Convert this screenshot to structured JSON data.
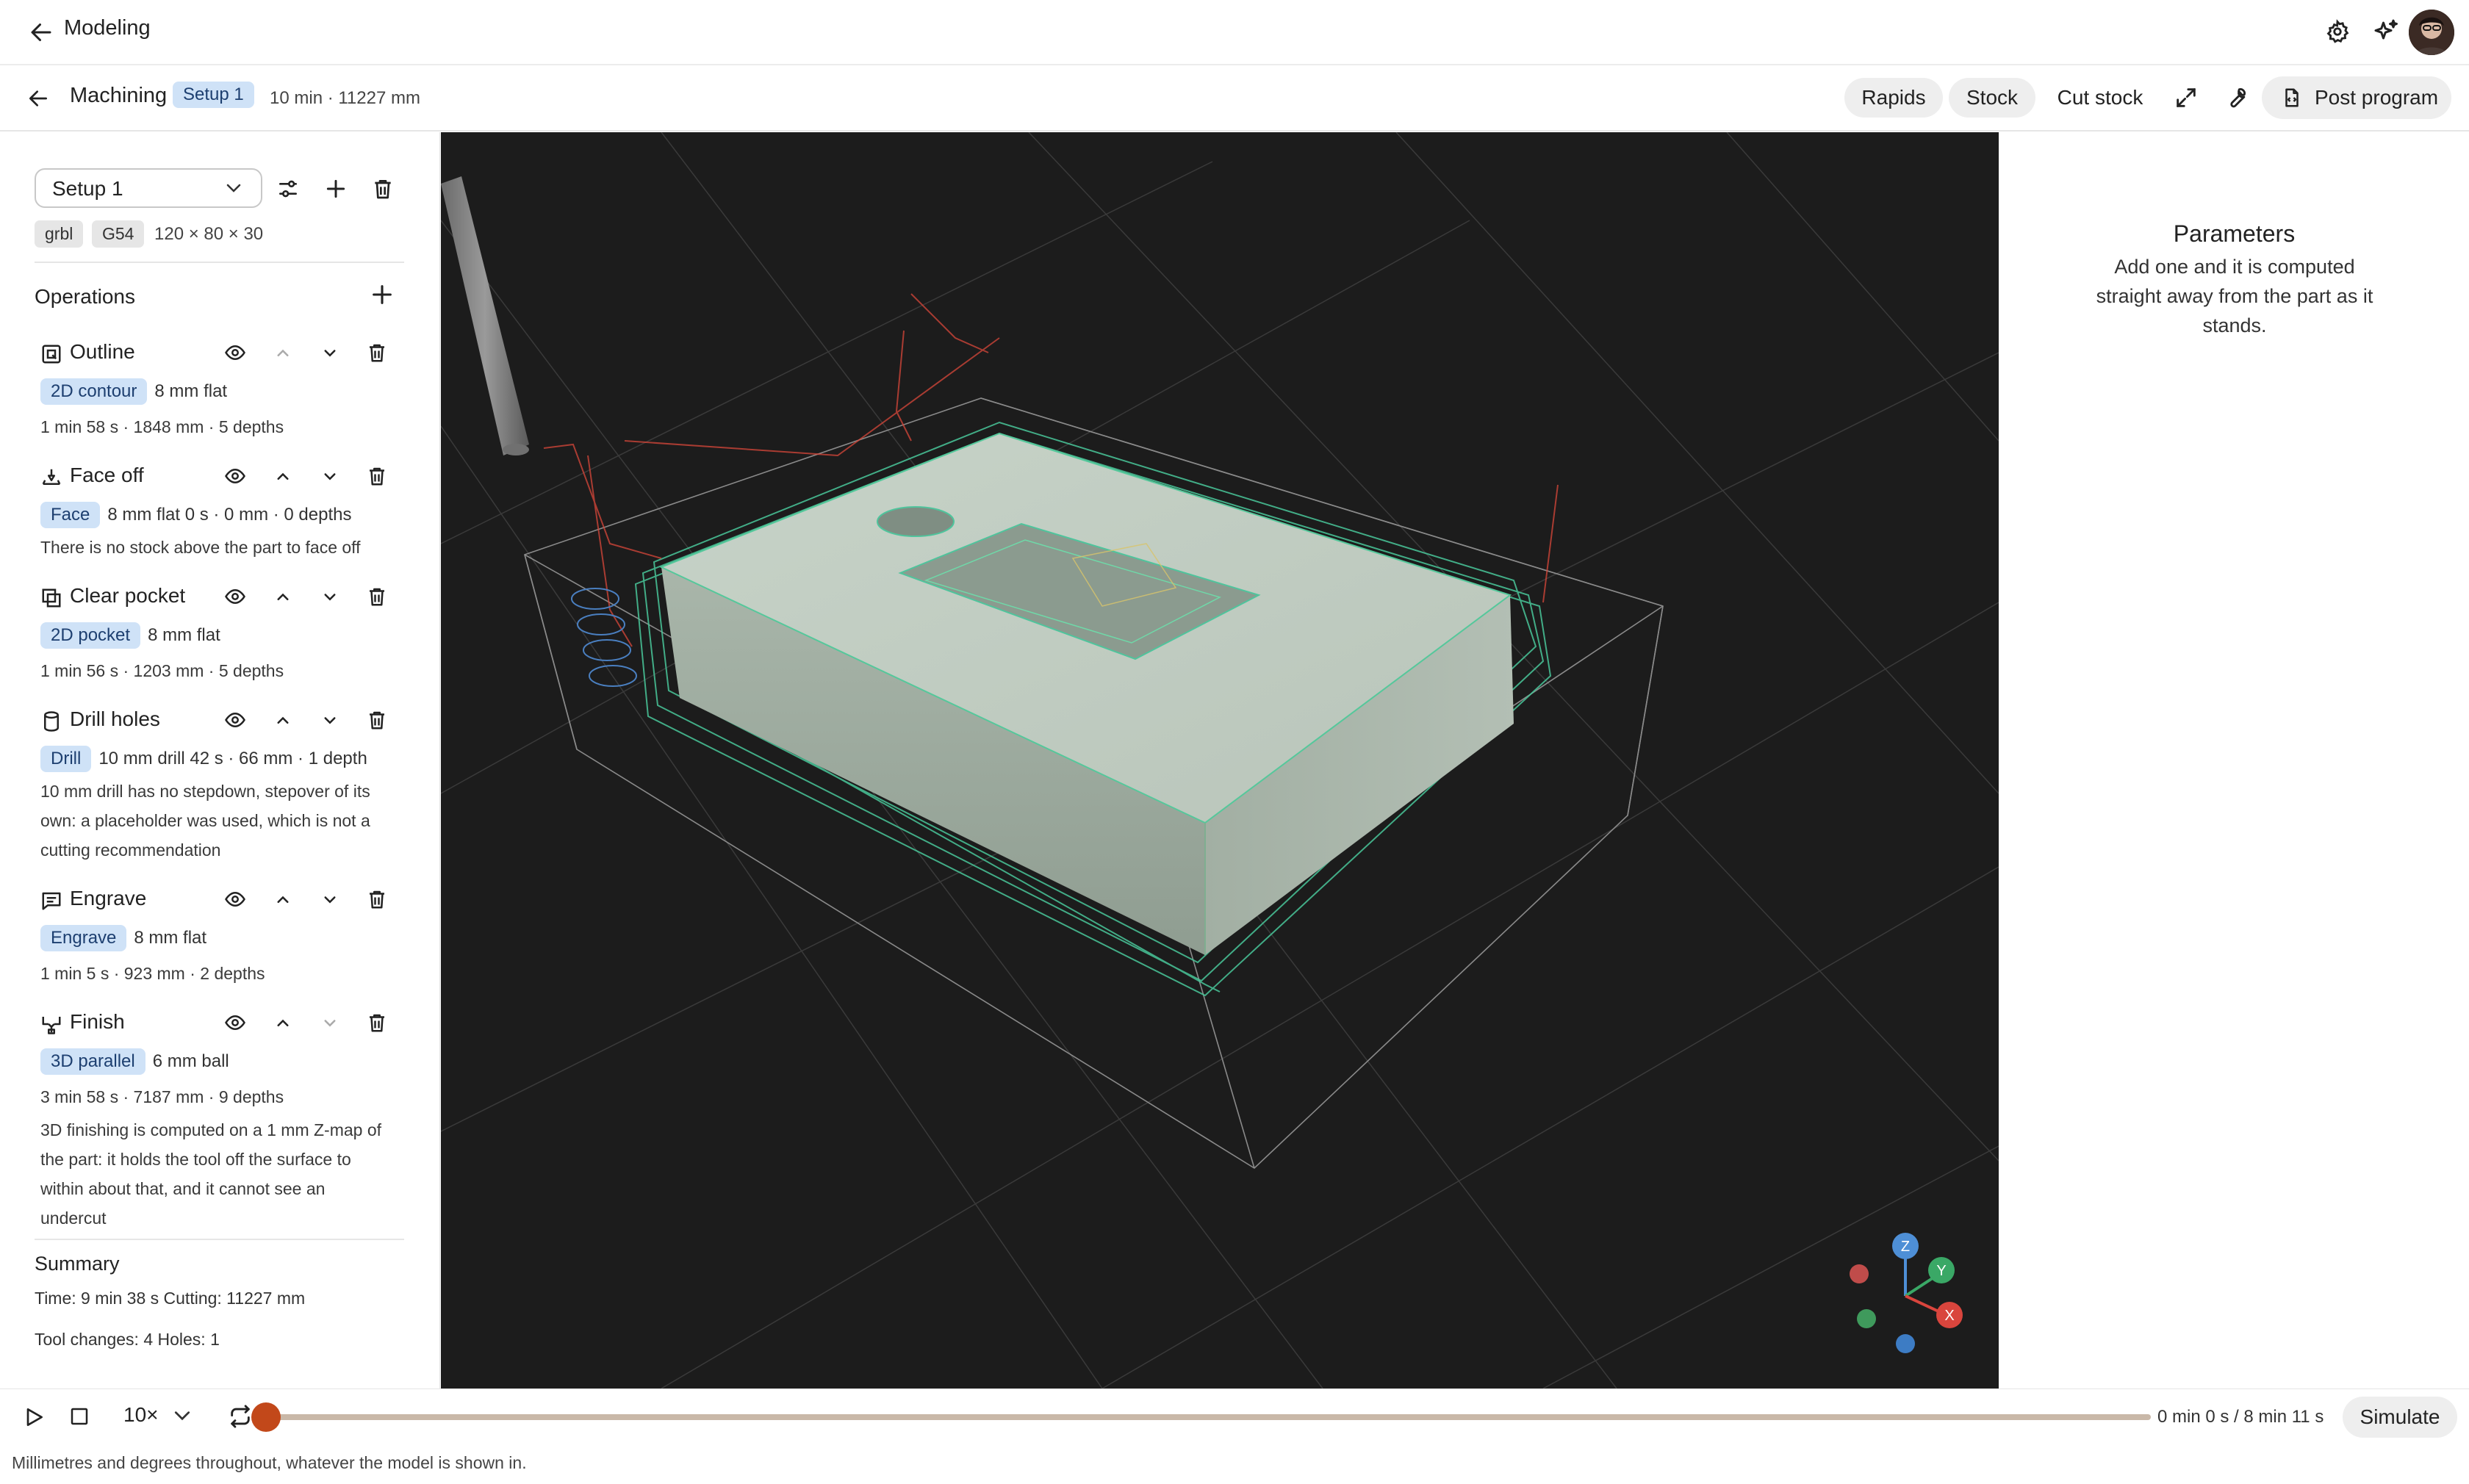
{
  "topbar": {
    "title": "Modeling"
  },
  "machining_bar": {
    "title": "Machining",
    "setup_badge": "Setup 1",
    "meta": "10 min · 11227 mm",
    "rapids": "Rapids",
    "stock": "Stock",
    "cut_stock": "Cut stock",
    "post_program": "Post program"
  },
  "sidebar": {
    "setup_select": "Setup 1",
    "chips": [
      "grbl",
      "G54"
    ],
    "dims": "120 × 80 × 30",
    "operations_title": "Operations",
    "operations": [
      {
        "name": "Outline",
        "icon": "outline-icon",
        "type": "2D contour",
        "tool": "8 mm flat",
        "stats": [
          "1 min 58 s · 1848 mm · 5 depths"
        ]
      },
      {
        "name": "Face off",
        "icon": "face-mill-icon",
        "type": "Face",
        "tool": "8 mm flat 0 s · 0 mm · 0 depths",
        "stats": [
          "There is no stock above the part to face off"
        ]
      },
      {
        "name": "Clear pocket",
        "icon": "pocket-icon",
        "type": "2D pocket",
        "tool": "8 mm flat",
        "stats": [
          "1 min 56 s · 1203 mm · 5 depths"
        ]
      },
      {
        "name": "Drill holes",
        "icon": "drill-icon",
        "type": "Drill",
        "tool": "10 mm drill 42 s · 66 mm · 1 depth",
        "stats": [
          "10 mm drill has no stepdown, stepover of its",
          "own: a placeholder was used, which is not a",
          "cutting recommendation"
        ]
      },
      {
        "name": "Engrave",
        "icon": "engrave-icon",
        "type": "Engrave",
        "tool": "8 mm flat",
        "stats": [
          "1 min 5 s · 923 mm · 2 depths"
        ]
      },
      {
        "name": "Finish",
        "icon": "finish-icon",
        "type": "3D parallel",
        "tool": "6 mm ball",
        "stats": [
          "3 min 58 s · 7187 mm · 9 depths",
          "3D finishing is computed on a 1 mm Z-map of",
          "the part: it holds the tool off the surface to",
          "within about that, and it cannot see an",
          "undercut"
        ]
      }
    ],
    "summary": {
      "title": "Summary",
      "time_line": "Time: 9 min 38 s  Cutting: 11227 mm",
      "tool_line": "Tool changes: 4  Holes: 1"
    }
  },
  "viewport": {
    "axes": {
      "z": "Z",
      "y": "Y",
      "x": "X"
    }
  },
  "parameters": {
    "title": "Parameters",
    "description": "Add one and it is computed straight away from the part as it stands."
  },
  "playback": {
    "speed": "10×",
    "progress": 0,
    "time": "0 min 0 s / 8 min 11 s",
    "simulate": "Simulate"
  },
  "footer": "Millimetres and degrees throughout, whatever the model is shown in."
}
